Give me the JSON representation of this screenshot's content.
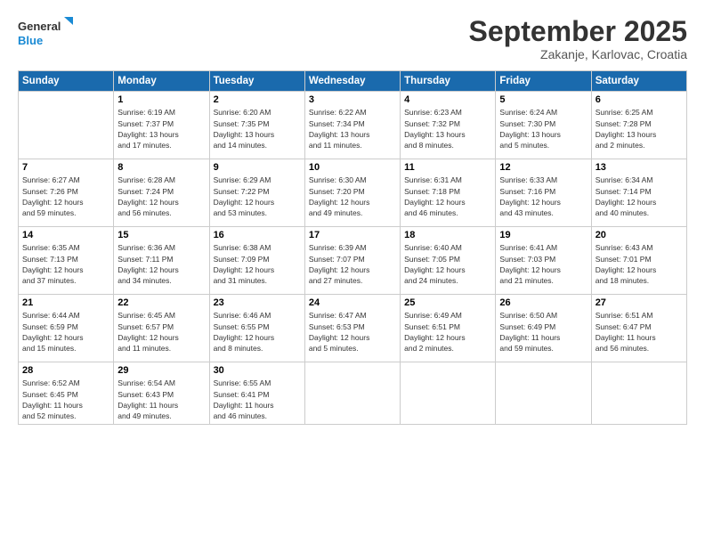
{
  "header": {
    "logo_general": "General",
    "logo_blue": "Blue",
    "month_title": "September 2025",
    "subtitle": "Zakanje, Karlovac, Croatia"
  },
  "days_of_week": [
    "Sunday",
    "Monday",
    "Tuesday",
    "Wednesday",
    "Thursday",
    "Friday",
    "Saturday"
  ],
  "weeks": [
    [
      {
        "day": "",
        "info": ""
      },
      {
        "day": "1",
        "info": "Sunrise: 6:19 AM\nSunset: 7:37 PM\nDaylight: 13 hours\nand 17 minutes."
      },
      {
        "day": "2",
        "info": "Sunrise: 6:20 AM\nSunset: 7:35 PM\nDaylight: 13 hours\nand 14 minutes."
      },
      {
        "day": "3",
        "info": "Sunrise: 6:22 AM\nSunset: 7:34 PM\nDaylight: 13 hours\nand 11 minutes."
      },
      {
        "day": "4",
        "info": "Sunrise: 6:23 AM\nSunset: 7:32 PM\nDaylight: 13 hours\nand 8 minutes."
      },
      {
        "day": "5",
        "info": "Sunrise: 6:24 AM\nSunset: 7:30 PM\nDaylight: 13 hours\nand 5 minutes."
      },
      {
        "day": "6",
        "info": "Sunrise: 6:25 AM\nSunset: 7:28 PM\nDaylight: 13 hours\nand 2 minutes."
      }
    ],
    [
      {
        "day": "7",
        "info": "Sunrise: 6:27 AM\nSunset: 7:26 PM\nDaylight: 12 hours\nand 59 minutes."
      },
      {
        "day": "8",
        "info": "Sunrise: 6:28 AM\nSunset: 7:24 PM\nDaylight: 12 hours\nand 56 minutes."
      },
      {
        "day": "9",
        "info": "Sunrise: 6:29 AM\nSunset: 7:22 PM\nDaylight: 12 hours\nand 53 minutes."
      },
      {
        "day": "10",
        "info": "Sunrise: 6:30 AM\nSunset: 7:20 PM\nDaylight: 12 hours\nand 49 minutes."
      },
      {
        "day": "11",
        "info": "Sunrise: 6:31 AM\nSunset: 7:18 PM\nDaylight: 12 hours\nand 46 minutes."
      },
      {
        "day": "12",
        "info": "Sunrise: 6:33 AM\nSunset: 7:16 PM\nDaylight: 12 hours\nand 43 minutes."
      },
      {
        "day": "13",
        "info": "Sunrise: 6:34 AM\nSunset: 7:14 PM\nDaylight: 12 hours\nand 40 minutes."
      }
    ],
    [
      {
        "day": "14",
        "info": "Sunrise: 6:35 AM\nSunset: 7:13 PM\nDaylight: 12 hours\nand 37 minutes."
      },
      {
        "day": "15",
        "info": "Sunrise: 6:36 AM\nSunset: 7:11 PM\nDaylight: 12 hours\nand 34 minutes."
      },
      {
        "day": "16",
        "info": "Sunrise: 6:38 AM\nSunset: 7:09 PM\nDaylight: 12 hours\nand 31 minutes."
      },
      {
        "day": "17",
        "info": "Sunrise: 6:39 AM\nSunset: 7:07 PM\nDaylight: 12 hours\nand 27 minutes."
      },
      {
        "day": "18",
        "info": "Sunrise: 6:40 AM\nSunset: 7:05 PM\nDaylight: 12 hours\nand 24 minutes."
      },
      {
        "day": "19",
        "info": "Sunrise: 6:41 AM\nSunset: 7:03 PM\nDaylight: 12 hours\nand 21 minutes."
      },
      {
        "day": "20",
        "info": "Sunrise: 6:43 AM\nSunset: 7:01 PM\nDaylight: 12 hours\nand 18 minutes."
      }
    ],
    [
      {
        "day": "21",
        "info": "Sunrise: 6:44 AM\nSunset: 6:59 PM\nDaylight: 12 hours\nand 15 minutes."
      },
      {
        "day": "22",
        "info": "Sunrise: 6:45 AM\nSunset: 6:57 PM\nDaylight: 12 hours\nand 11 minutes."
      },
      {
        "day": "23",
        "info": "Sunrise: 6:46 AM\nSunset: 6:55 PM\nDaylight: 12 hours\nand 8 minutes."
      },
      {
        "day": "24",
        "info": "Sunrise: 6:47 AM\nSunset: 6:53 PM\nDaylight: 12 hours\nand 5 minutes."
      },
      {
        "day": "25",
        "info": "Sunrise: 6:49 AM\nSunset: 6:51 PM\nDaylight: 12 hours\nand 2 minutes."
      },
      {
        "day": "26",
        "info": "Sunrise: 6:50 AM\nSunset: 6:49 PM\nDaylight: 11 hours\nand 59 minutes."
      },
      {
        "day": "27",
        "info": "Sunrise: 6:51 AM\nSunset: 6:47 PM\nDaylight: 11 hours\nand 56 minutes."
      }
    ],
    [
      {
        "day": "28",
        "info": "Sunrise: 6:52 AM\nSunset: 6:45 PM\nDaylight: 11 hours\nand 52 minutes."
      },
      {
        "day": "29",
        "info": "Sunrise: 6:54 AM\nSunset: 6:43 PM\nDaylight: 11 hours\nand 49 minutes."
      },
      {
        "day": "30",
        "info": "Sunrise: 6:55 AM\nSunset: 6:41 PM\nDaylight: 11 hours\nand 46 minutes."
      },
      {
        "day": "",
        "info": ""
      },
      {
        "day": "",
        "info": ""
      },
      {
        "day": "",
        "info": ""
      },
      {
        "day": "",
        "info": ""
      }
    ]
  ]
}
